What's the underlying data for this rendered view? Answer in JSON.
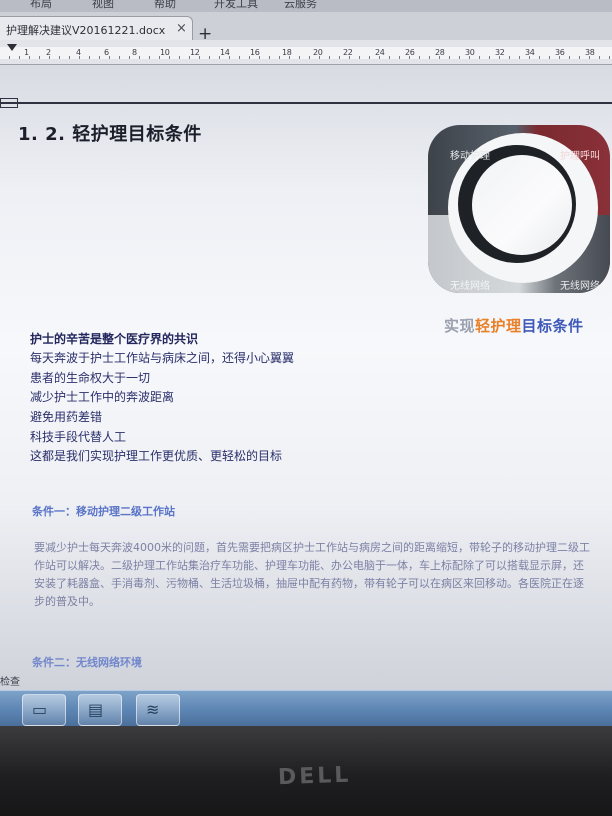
{
  "menu": {
    "items": [
      "布局",
      "视图",
      "帮助",
      "开发工具",
      "云服务"
    ]
  },
  "tab": {
    "title": "护理解决建议V20161221.docx",
    "close": "×",
    "add": "+"
  },
  "ruler": {
    "labels": [
      "1",
      "2",
      "4",
      "6",
      "8",
      "10",
      "12",
      "14",
      "16",
      "18",
      "20",
      "22",
      "24",
      "26",
      "28",
      "30",
      "32",
      "34",
      "36",
      "38"
    ]
  },
  "document": {
    "heading": "1. 2. 轻护理目标条件",
    "graphic": {
      "labels": [
        "移动护理",
        "护理呼叫",
        "无线网络",
        "无线网络"
      ],
      "caption_part1": "实现",
      "caption_part2": "轻护理",
      "caption_part3": "目标条件",
      "colors": {
        "caption_gray": "#9aa0ae",
        "caption_orange": "#e8812a",
        "caption_blue": "#3d59b8"
      }
    },
    "paragraph": [
      "护士的辛苦是整个医疗界的共识",
      "每天奔波于护士工作站与病床之间，还得小心翼翼",
      "患者的生命权大于一切",
      "减少护士工作中的奔波距离",
      "避免用药差错",
      "科技手段代替人工",
      "这都是我们实现护理工作更优质、更轻松的目标"
    ],
    "condition1": "条件一：移动护理二级工作站",
    "body_text": "要减少护士每天奔波4000米的问题，首先需要把病区护士工作站与病房之间的距离缩短，带轮子的移动护理二级工作站可以解决。二级护理工作站集治疗车功能、护理车功能、办公电脑于一体，车上标配除了可以搭载显示屏，还安装了耗器盒、手消毒剂、污物桶、生活垃圾桶，抽屉中配有药物，带有轮子可以在病区来回移动。各医院正在逐步的普及中。",
    "condition2": "条件二：无线网络环境",
    "status_left": "检查"
  },
  "taskbar": {
    "icons": [
      "folder-icon",
      "explorer-icon",
      "document-app-icon"
    ]
  },
  "bezel": {
    "brand": "DELL"
  }
}
